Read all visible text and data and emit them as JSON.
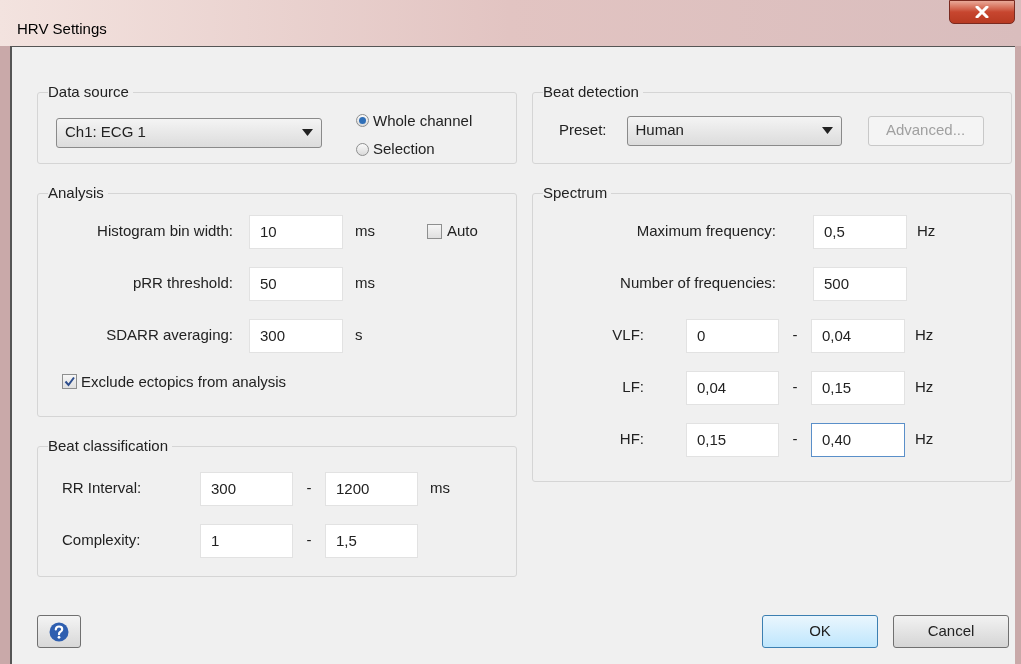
{
  "window": {
    "title": "HRV Settings"
  },
  "data_source": {
    "title": "Data source",
    "channel": "Ch1: ECG 1",
    "options": [
      {
        "label": "Whole channel",
        "selected": true
      },
      {
        "label": "Selection",
        "selected": false
      }
    ]
  },
  "analysis": {
    "title": "Analysis",
    "fields": [
      {
        "label": "Histogram bin width:",
        "value": "10",
        "unit": "ms",
        "auto": {
          "label": "Auto",
          "checked": false
        }
      },
      {
        "label": "pRR threshold:",
        "value": "50",
        "unit": "ms"
      },
      {
        "label": "SDARR averaging:",
        "value": "300",
        "unit": "s"
      }
    ],
    "exclude": {
      "label": "Exclude ectopics from analysis",
      "checked": true
    }
  },
  "beat_classification": {
    "title": "Beat classification",
    "ranges": [
      {
        "label": "RR Interval:",
        "from": "300",
        "separator": "-",
        "to": "1200",
        "unit": "ms"
      },
      {
        "label": "Complexity:",
        "from": "1",
        "separator": "-",
        "to": "1,5"
      }
    ]
  },
  "beat_detection": {
    "title": "Beat detection",
    "preset_label": "Preset:",
    "preset": "Human",
    "advanced": {
      "label": "Advanced...",
      "disabled": true
    }
  },
  "spectrum": {
    "title": "Spectrum",
    "fields": [
      {
        "label": "Maximum frequency:",
        "value": "0,5",
        "unit": "Hz"
      },
      {
        "label": "Number of frequencies:",
        "value": "500"
      }
    ],
    "bands": [
      {
        "label": "VLF:",
        "from": "0",
        "separator": "-",
        "to": "0,04",
        "unit": "Hz",
        "focused": false
      },
      {
        "label": "LF:",
        "from": "0,04",
        "separator": "-",
        "to": "0,15",
        "unit": "Hz",
        "focused": false
      },
      {
        "label": "HF:",
        "from": "0,15",
        "separator": "-",
        "to": "0,40",
        "unit": "Hz",
        "focused": true
      }
    ]
  },
  "buttons": [
    {
      "kind": "help"
    },
    {
      "kind": "text",
      "label": "OK",
      "default": true
    },
    {
      "kind": "text",
      "label": "Cancel",
      "default": false
    }
  ]
}
